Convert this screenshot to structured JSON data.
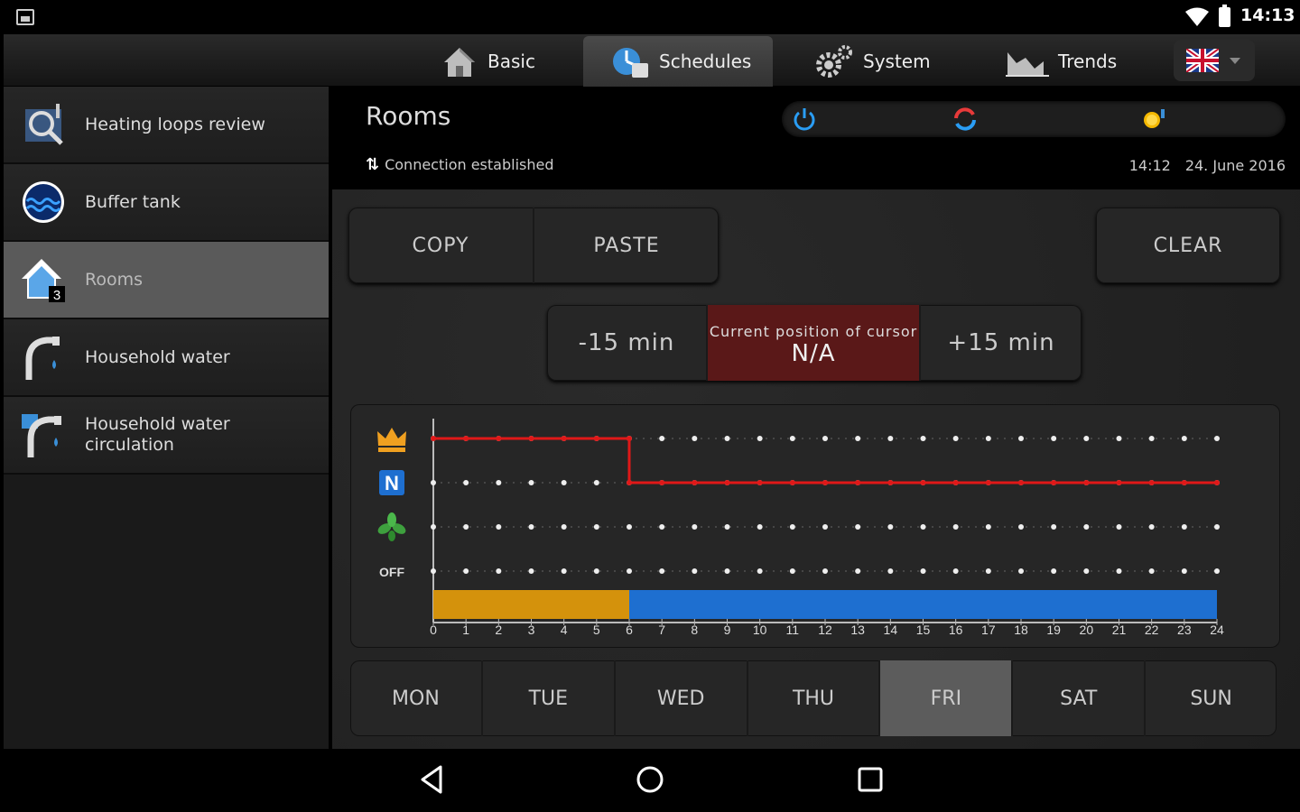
{
  "status_bar": {
    "time": "14:13"
  },
  "top_tabs": [
    {
      "label": "Basic",
      "icon": "house-icon"
    },
    {
      "label": "Schedules",
      "icon": "schedule-icon",
      "active": true
    },
    {
      "label": "System",
      "icon": "gears-icon"
    },
    {
      "label": "Trends",
      "icon": "trends-icon"
    }
  ],
  "language": {
    "icon": "uk-flag-icon"
  },
  "sidebar": {
    "items": [
      {
        "label": "Heating loops review",
        "icon": "heating-loops-icon"
      },
      {
        "label": "Buffer tank",
        "icon": "buffer-tank-icon"
      },
      {
        "label": "Rooms",
        "icon": "rooms-house-icon",
        "badge": "3",
        "active": true
      },
      {
        "label": "Household water",
        "icon": "water-tap-icon"
      },
      {
        "label": "Household water\ncirculation",
        "icon": "water-circulation-icon"
      }
    ]
  },
  "header": {
    "title": "Rooms",
    "connection": "Connection established",
    "time": "14:12",
    "date": "24. June 2016",
    "mode_icons": [
      "power-icon",
      "refresh-icon",
      "sun-icon"
    ]
  },
  "actions": {
    "copy": "COPY",
    "paste": "PASTE",
    "clear": "CLEAR"
  },
  "cursor": {
    "minus": "-15 min",
    "plus": "+15 min",
    "label": "Current position of cursor",
    "value": "N/A"
  },
  "chart_data": {
    "type": "line",
    "levels": [
      "crown-icon",
      "N",
      "eco-leaf-icon",
      "OFF"
    ],
    "x": [
      0,
      1,
      2,
      3,
      4,
      5,
      6,
      7,
      8,
      9,
      10,
      11,
      12,
      13,
      14,
      15,
      16,
      17,
      18,
      19,
      20,
      21,
      22,
      23,
      24
    ],
    "xlim": [
      0,
      24
    ],
    "schedule": [
      {
        "from": 0,
        "to": 6,
        "level": 0,
        "color": "#d4920c"
      },
      {
        "from": 6,
        "to": 24,
        "level": 1,
        "color": "#1e6fd0"
      }
    ],
    "line_color": "#e01818"
  },
  "days": [
    {
      "label": "MON"
    },
    {
      "label": "TUE"
    },
    {
      "label": "WED"
    },
    {
      "label": "THU"
    },
    {
      "label": "FRI",
      "active": true
    },
    {
      "label": "SAT"
    },
    {
      "label": "SUN"
    }
  ],
  "navbar": [
    "back-icon",
    "home-icon",
    "recents-icon"
  ]
}
